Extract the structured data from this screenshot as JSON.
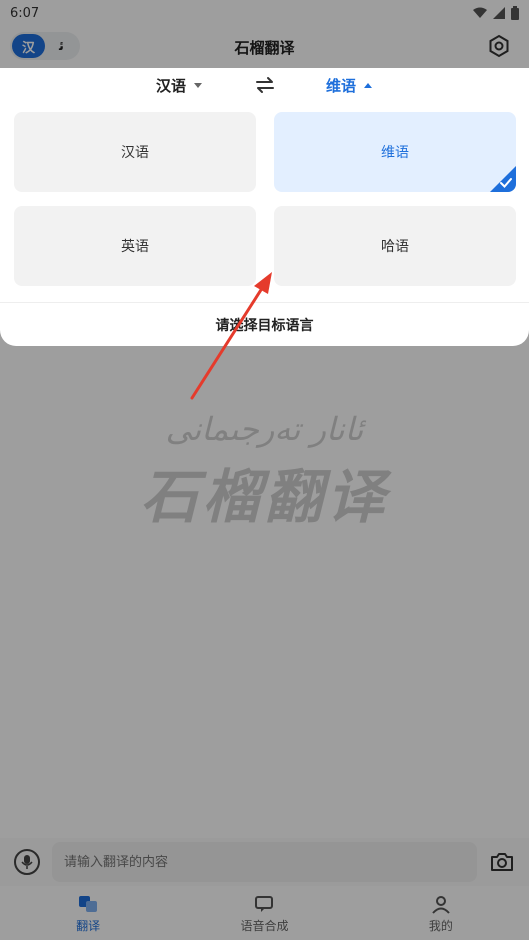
{
  "status_bar": {
    "time": "6:07"
  },
  "header": {
    "script_toggle": {
      "active": "汉",
      "inactive": "ﺋ"
    },
    "title": "石榴翻译"
  },
  "language_bar": {
    "source": "汉语",
    "target": "维语"
  },
  "sheet": {
    "languages": [
      {
        "label": "汉语",
        "selected": false
      },
      {
        "label": "维语",
        "selected": true
      },
      {
        "label": "英语",
        "selected": false
      },
      {
        "label": "哈语",
        "selected": false
      }
    ],
    "footer": "请选择目标语言"
  },
  "watermark": {
    "uyghur": "ئانار تەرجىمانى",
    "chinese": "石榴翻译"
  },
  "input": {
    "placeholder": "请输入翻译的内容"
  },
  "tabs": [
    {
      "label": "翻译",
      "active": true,
      "icon": "translate-icon"
    },
    {
      "label": "语音合成",
      "active": false,
      "icon": "speech-icon"
    },
    {
      "label": "我的",
      "active": false,
      "icon": "profile-icon"
    }
  ],
  "colors": {
    "accent": "#1e6fdb",
    "overlay": "rgba(0,0,0,0.38)",
    "annotation_arrow": "#e53b2c"
  }
}
